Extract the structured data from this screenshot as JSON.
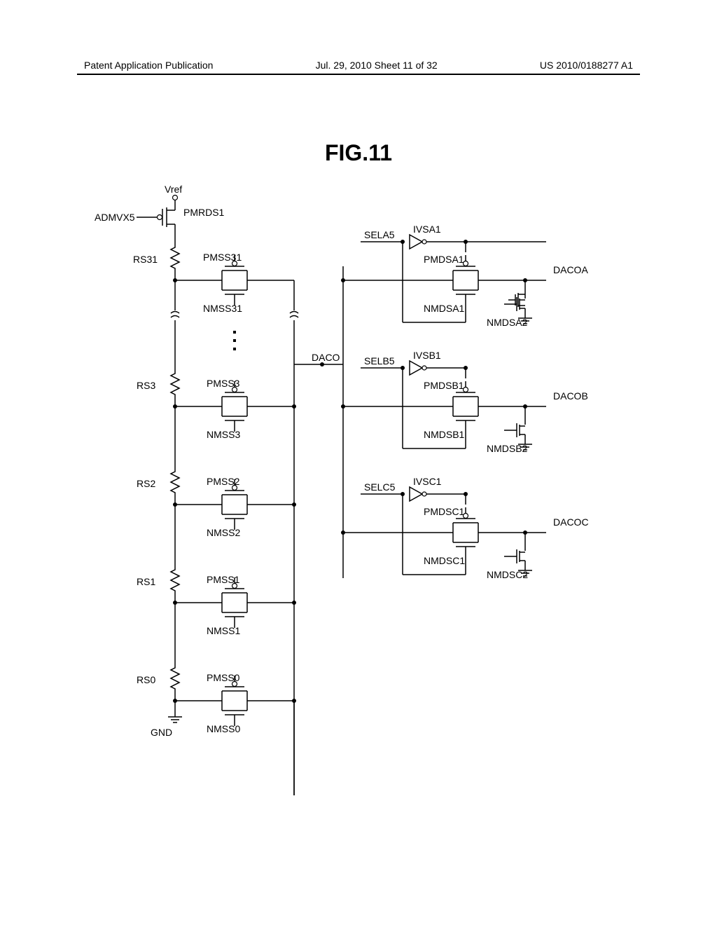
{
  "header": {
    "left": "Patent Application Publication",
    "center": "Jul. 29, 2010   Sheet 11 of 32",
    "right": "US 2010/0188277 A1"
  },
  "figure_title": "FIG.11",
  "labels": {
    "vref": "Vref",
    "admvx5": "ADMVX5",
    "pmrds1": "PMRDS1",
    "rs31": "RS31",
    "pmss31": "PMSS31",
    "nmss31": "NMSS31",
    "rs3": "RS3",
    "pmss3": "PMSS3",
    "nmss3": "NMSS3",
    "rs2": "RS2",
    "pmss2": "PMSS2",
    "nmss2": "NMSS2",
    "rs1": "RS1",
    "pmss1": "PMSS1",
    "nmss1": "NMSS1",
    "rs0": "RS0",
    "pmss0": "PMSS0",
    "nmss0": "NMSS0",
    "gnd": "GND",
    "daco": "DACO",
    "sela5": "SELA5",
    "ivsa1": "IVSA1",
    "pmdsa1": "PMDSA1",
    "nmdsa1": "NMDSA1",
    "nmdsa2": "NMDSA2",
    "dacoa": "DACOA",
    "selb5": "SELB5",
    "ivsb1": "IVSB1",
    "pmdsb1": "PMDSB1",
    "nmdsb1": "NMDSB1",
    "nmdsb2": "NMDSB2",
    "dacob": "DACOB",
    "selc5": "SELC5",
    "ivsc1": "IVSC1",
    "pmdsc1": "PMDSC1",
    "nmdsc1": "NMDSC1",
    "nmdsc2": "NMDSC2",
    "dacoc": "DACOC"
  },
  "chart_data": {
    "type": "circuit-diagram",
    "description": "Resistor string DAC with transmission gate multiplexers and three output branches A, B, C",
    "left_column": {
      "input": "Vref via PMOS PMRDS1 gated by ADMVX5",
      "resistor_string": [
        "RS31",
        "...",
        "RS3",
        "RS2",
        "RS1",
        "RS0"
      ],
      "bottom": "GND",
      "tap_switches": [
        {
          "upper": "PMSS31",
          "lower": "NMSS31"
        },
        {
          "upper": "PMSS3",
          "lower": "NMSS3"
        },
        {
          "upper": "PMSS2",
          "lower": "NMSS2"
        },
        {
          "upper": "PMSS1",
          "lower": "NMSS1"
        },
        {
          "upper": "PMSS0",
          "lower": "NMSS0"
        }
      ],
      "common_output": "DACO"
    },
    "right_branches": [
      {
        "select": "SELA5",
        "inverter": "IVSA1",
        "pmos": "PMDSA1",
        "nmos": "NMDSA1",
        "pulldown": "NMDSA2",
        "output": "DACOA"
      },
      {
        "select": "SELB5",
        "inverter": "IVSB1",
        "pmos": "PMDSB1",
        "nmos": "NMDSB1",
        "pulldown": "NMDSB2",
        "output": "DACOB"
      },
      {
        "select": "SELC5",
        "inverter": "IVSC1",
        "pmos": "PMDSC1",
        "nmos": "NMDSC1",
        "pulldown": "NMDSC2",
        "output": "DACOC"
      }
    ]
  }
}
